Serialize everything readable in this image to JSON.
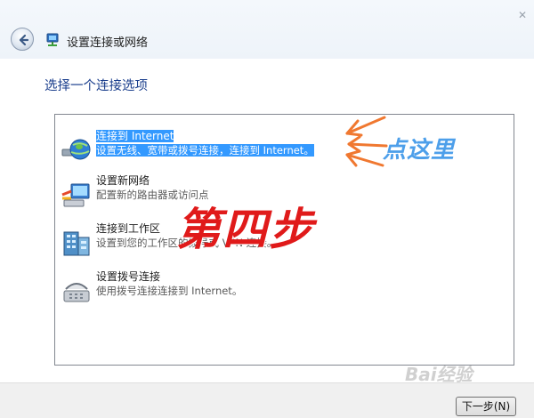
{
  "window": {
    "title": "设置连接或网络",
    "close_glyph": "✕",
    "back_icon": "back-arrow-icon",
    "title_icon": "network-wizard-icon"
  },
  "heading": "选择一个连接选项",
  "options": [
    {
      "title": "连接到 Internet",
      "description": "设置无线、宽带或拨号连接，连接到 Internet。",
      "icon": "globe-network-icon",
      "selected": true
    },
    {
      "title": "设置新网络",
      "description": "配置新的路由器或访问点",
      "icon": "router-setup-icon",
      "selected": false
    },
    {
      "title": "连接到工作区",
      "description": "设置到您的工作区的拨号或 VPN 连接。",
      "icon": "workplace-building-icon",
      "selected": false
    },
    {
      "title": "设置拨号连接",
      "description": "使用拨号连接连接到 Internet。",
      "icon": "telephone-modem-icon",
      "selected": false
    }
  ],
  "annotations": {
    "click_here": "点这里",
    "step": "第四步"
  },
  "footer": {
    "next_button": "下一步(N)"
  },
  "watermark": "Bai经验",
  "colors": {
    "selection": "#3399ff",
    "heading": "#1b3f8d",
    "annotation_red": "#e01a1a",
    "annotation_blue": "#4d9fea",
    "arrow_orange": "#f07830"
  }
}
